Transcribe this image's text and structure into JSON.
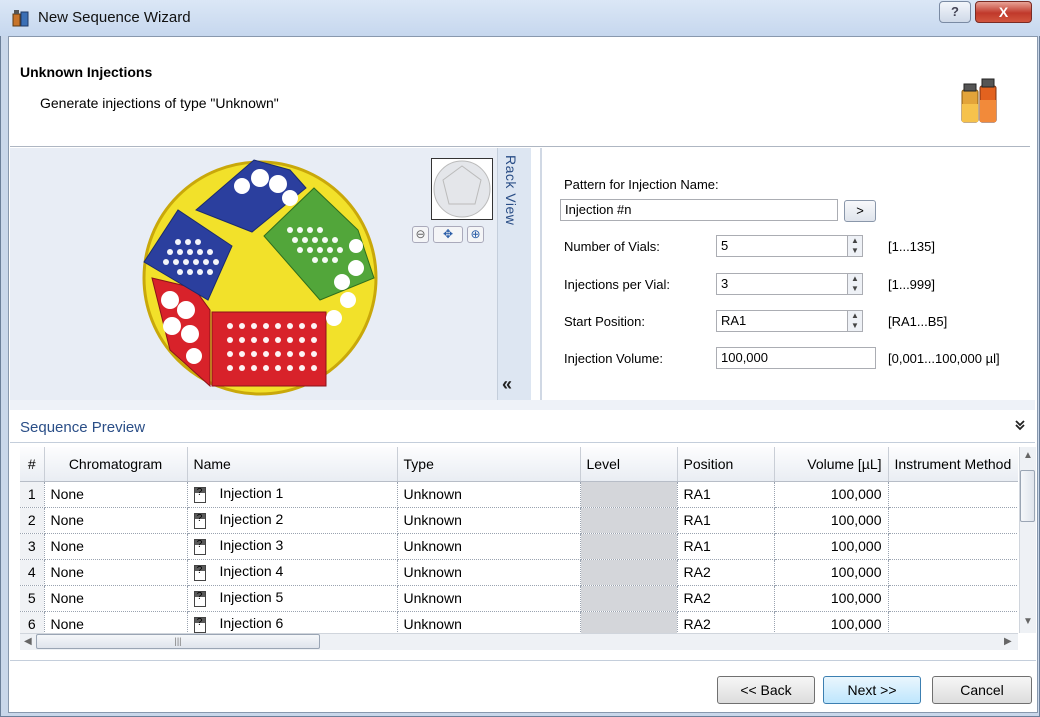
{
  "window": {
    "title": "New Sequence Wizard",
    "help_label": "?",
    "close_label": "X"
  },
  "header": {
    "title": "Unknown Injections",
    "subtitle": "Generate injections of type \"Unknown\""
  },
  "rack_view": {
    "label": "Rack View",
    "collapse_label": "«"
  },
  "form": {
    "pattern_label": "Pattern for Injection Name:",
    "pattern_value": "Injection #n",
    "pattern_button": ">",
    "vials_label": "Number of Vials:",
    "vials_value": "5",
    "vials_range": "[1...135]",
    "inj_label": "Injections per Vial:",
    "inj_value": "3",
    "inj_range": "[1...999]",
    "start_label": "Start Position:",
    "start_value": "RA1",
    "start_range": "[RA1...B5]",
    "volume_label": "Injection Volume:",
    "volume_value": "100,000",
    "volume_range": "[0,001...100,000 µl]"
  },
  "preview": {
    "title": "Sequence Preview",
    "toggle": "»",
    "columns": [
      "#",
      "Chromatogram",
      "Name",
      "Type",
      "Level",
      "Position",
      "Volume [µL]",
      "Instrument Method"
    ],
    "rows": [
      {
        "n": "1",
        "chrom": "None",
        "name": "Injection 1",
        "type": "Unknown",
        "level": "",
        "pos": "RA1",
        "vol": "100,000",
        "method": ""
      },
      {
        "n": "2",
        "chrom": "None",
        "name": "Injection 2",
        "type": "Unknown",
        "level": "",
        "pos": "RA1",
        "vol": "100,000",
        "method": ""
      },
      {
        "n": "3",
        "chrom": "None",
        "name": "Injection 3",
        "type": "Unknown",
        "level": "",
        "pos": "RA1",
        "vol": "100,000",
        "method": ""
      },
      {
        "n": "4",
        "chrom": "None",
        "name": "Injection 4",
        "type": "Unknown",
        "level": "",
        "pos": "RA2",
        "vol": "100,000",
        "method": ""
      },
      {
        "n": "5",
        "chrom": "None",
        "name": "Injection 5",
        "type": "Unknown",
        "level": "",
        "pos": "RA2",
        "vol": "100,000",
        "method": ""
      },
      {
        "n": "6",
        "chrom": "None",
        "name": "Injection 6",
        "type": "Unknown",
        "level": "",
        "pos": "RA2",
        "vol": "100,000",
        "method": ""
      }
    ]
  },
  "buttons": {
    "back": "<< Back",
    "next": "Next >>",
    "cancel": "Cancel"
  },
  "colors": {
    "accent": "#2a4e87",
    "rack_yellow": "#f2e12a",
    "rack_blue": "#2b3f9e",
    "rack_green": "#52a63a",
    "rack_red": "#d8222a"
  }
}
